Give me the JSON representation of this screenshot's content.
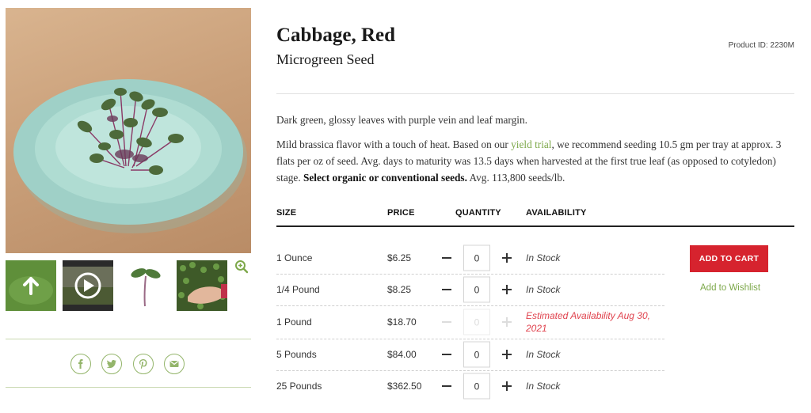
{
  "product": {
    "title": "Cabbage, Red",
    "subtitle": "Microgreen Seed",
    "product_id": "Product ID: 2230M"
  },
  "description": {
    "summary": "Dark green, glossy leaves with purple vein and leaf margin.",
    "detail_before_link": "Mild brassica flavor with a touch of heat. Based on our ",
    "link_text": "yield trial",
    "detail_after_link": ", we recommend seeding 10.5 gm per tray at approx. 3 flats per oz of seed. Avg. days to maturity was 13.5 days when harvested at the first true leaf (as opposed to cotyledon) stage. ",
    "bold_text": "Select organic or conventional seeds.",
    "detail_end": " Avg. 113,800 seeds/lb."
  },
  "table": {
    "headers": {
      "size": "SIZE",
      "price": "PRICE",
      "quantity": "QUANTITY",
      "availability": "AVAILABILITY"
    },
    "rows": [
      {
        "size": "1 Ounce",
        "price": "$6.25",
        "qty": "0",
        "availability": "In Stock"
      },
      {
        "size": "1/4 Pound",
        "price": "$8.25",
        "qty": "0",
        "availability": "In Stock"
      },
      {
        "size": "1 Pound",
        "price": "$18.70",
        "qty": "0",
        "availability": "Estimated Availability Aug 30, 2021"
      },
      {
        "size": "5 Pounds",
        "price": "$84.00",
        "qty": "0",
        "availability": "In Stock"
      },
      {
        "size": "25 Pounds",
        "price": "$362.50",
        "qty": "0",
        "availability": "In Stock"
      }
    ]
  },
  "actions": {
    "add_to_cart": "ADD TO CART",
    "wishlist": "Add to Wishlist"
  },
  "gallery": {
    "thumbnails": [
      "scroll-up-icon",
      "video-play-icon",
      "seedling-icon",
      "hand-microgreens-image"
    ],
    "zoom_icon": "zoom-in-icon"
  },
  "share": {
    "icons": [
      "facebook-icon",
      "twitter-icon",
      "pinterest-icon",
      "email-icon"
    ]
  },
  "colors": {
    "accent_green": "#7da84a",
    "cart_red": "#d6232e",
    "warning_red": "#e0434e"
  }
}
